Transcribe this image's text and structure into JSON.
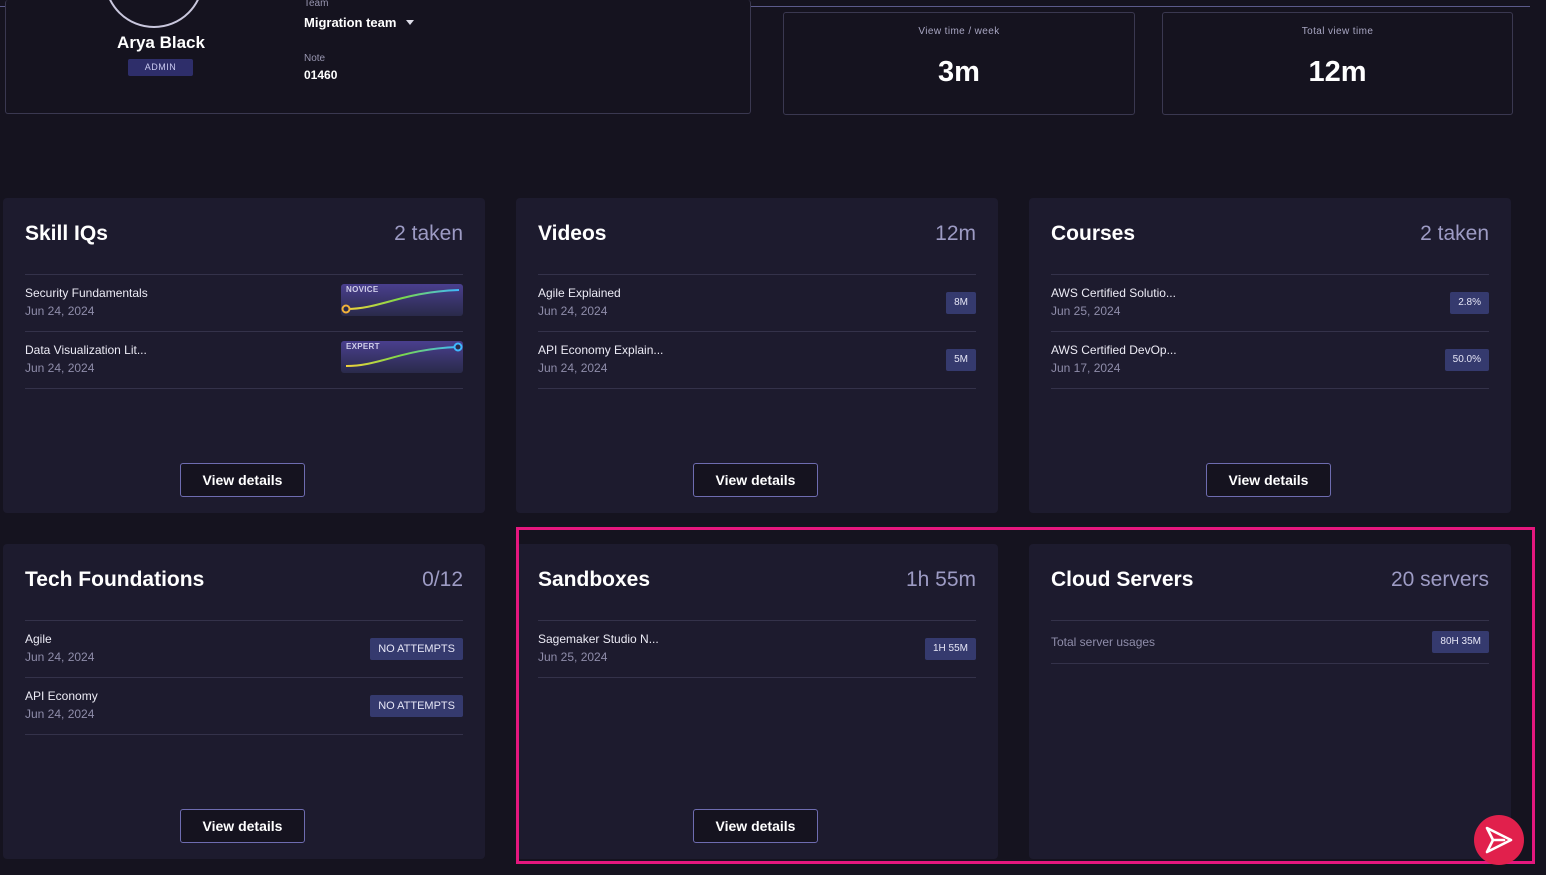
{
  "profile": {
    "name": "Arya Black",
    "role": "ADMIN",
    "team_label": "Team",
    "team_value": "Migration team",
    "note_label": "Note",
    "note_value": "01460"
  },
  "stats": [
    {
      "label": "View time / week",
      "value": "3m"
    },
    {
      "label": "Total view time",
      "value": "12m"
    }
  ],
  "cards": {
    "skill_iqs": {
      "title": "Skill IQs",
      "summary": "2 taken",
      "items": [
        {
          "name": "Security Fundamentals",
          "date": "Jun 24, 2024",
          "level": "NOVICE",
          "level_fraction": 0.0
        },
        {
          "name": "Data Visualization Lit...",
          "date": "Jun 24, 2024",
          "level": "EXPERT",
          "level_fraction": 1.0
        }
      ],
      "button": "View details"
    },
    "videos": {
      "title": "Videos",
      "summary": "12m",
      "items": [
        {
          "name": "Agile Explained",
          "date": "Jun 24, 2024",
          "tag": "8M"
        },
        {
          "name": "API Economy Explain...",
          "date": "Jun 24, 2024",
          "tag": "5M"
        }
      ],
      "button": "View details"
    },
    "courses": {
      "title": "Courses",
      "summary": "2 taken",
      "items": [
        {
          "name": "AWS Certified Solutio...",
          "date": "Jun 25, 2024",
          "tag": "2.8%"
        },
        {
          "name": "AWS Certified DevOp...",
          "date": "Jun 17, 2024",
          "tag": "50.0%"
        }
      ],
      "button": "View details"
    },
    "tech_foundations": {
      "title": "Tech Foundations",
      "summary": "0/12",
      "items": [
        {
          "name": "Agile",
          "date": "Jun 24, 2024",
          "tag": "NO ATTEMPTS"
        },
        {
          "name": "API Economy",
          "date": "Jun 24, 2024",
          "tag": "NO ATTEMPTS"
        }
      ],
      "button": "View details"
    },
    "sandboxes": {
      "title": "Sandboxes",
      "summary": "1h 55m",
      "items": [
        {
          "name": "Sagemaker Studio N...",
          "date": "Jun 25, 2024",
          "tag": "1H 55M"
        }
      ],
      "button": "View details"
    },
    "cloud_servers": {
      "title": "Cloud Servers",
      "summary": "20 servers",
      "usage_label": "Total server usages",
      "usage_tag": "80H 35M"
    }
  },
  "fab": {
    "icon": "play-arrow-icon"
  },
  "colors": {
    "highlight": "#e5177e",
    "fab": "#e1204c",
    "tag_bg": "#353a6e",
    "card_bg": "#1d1b2e"
  }
}
